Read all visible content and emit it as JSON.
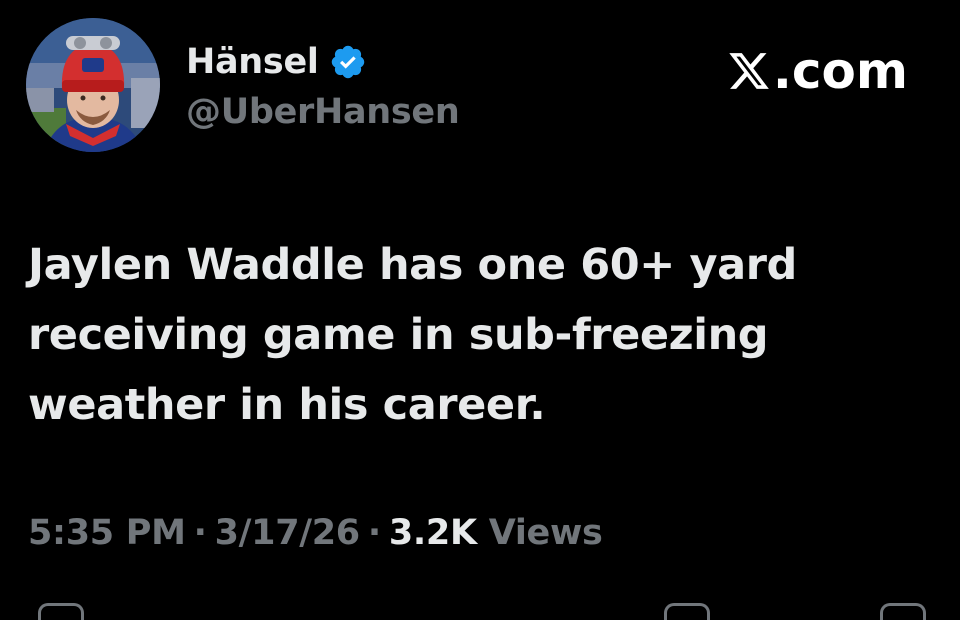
{
  "author": {
    "display_name": "Hänsel",
    "handle": "@UberHansen",
    "verified_icon": "verified-badge-icon",
    "verified_color": "#1d9bf0"
  },
  "brand": {
    "label": ".com",
    "icon": "x-logo-icon"
  },
  "tweet": {
    "text": "Jaylen Waddle has one 60+ yard\nreceiving game in sub-freezing\nweather in his career."
  },
  "meta": {
    "time": "5:35 PM",
    "separator": "·",
    "date": "3/17/26",
    "views_count": "3.2K",
    "views_label": "Views"
  },
  "colors": {
    "background": "#000000",
    "primary_text": "#e7e9ea",
    "secondary_text": "#71767b"
  }
}
